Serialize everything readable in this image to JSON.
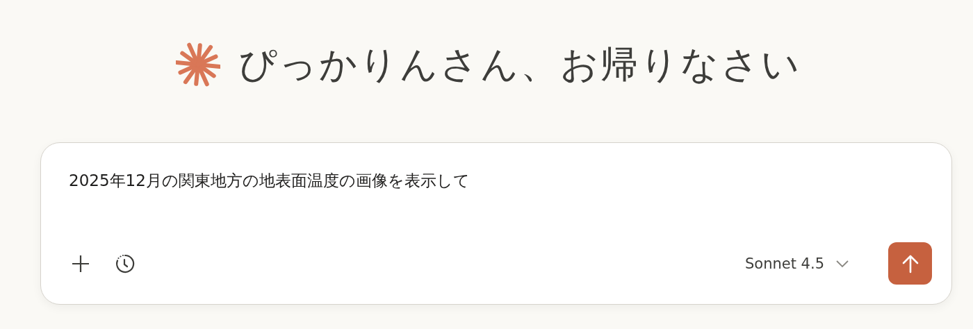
{
  "greeting": "ぴっかりんさん、お帰りなさい",
  "composer": {
    "value": "2025年12月の関東地方の地表面温度の画像を表示して",
    "model": "Sonnet 4.5"
  }
}
